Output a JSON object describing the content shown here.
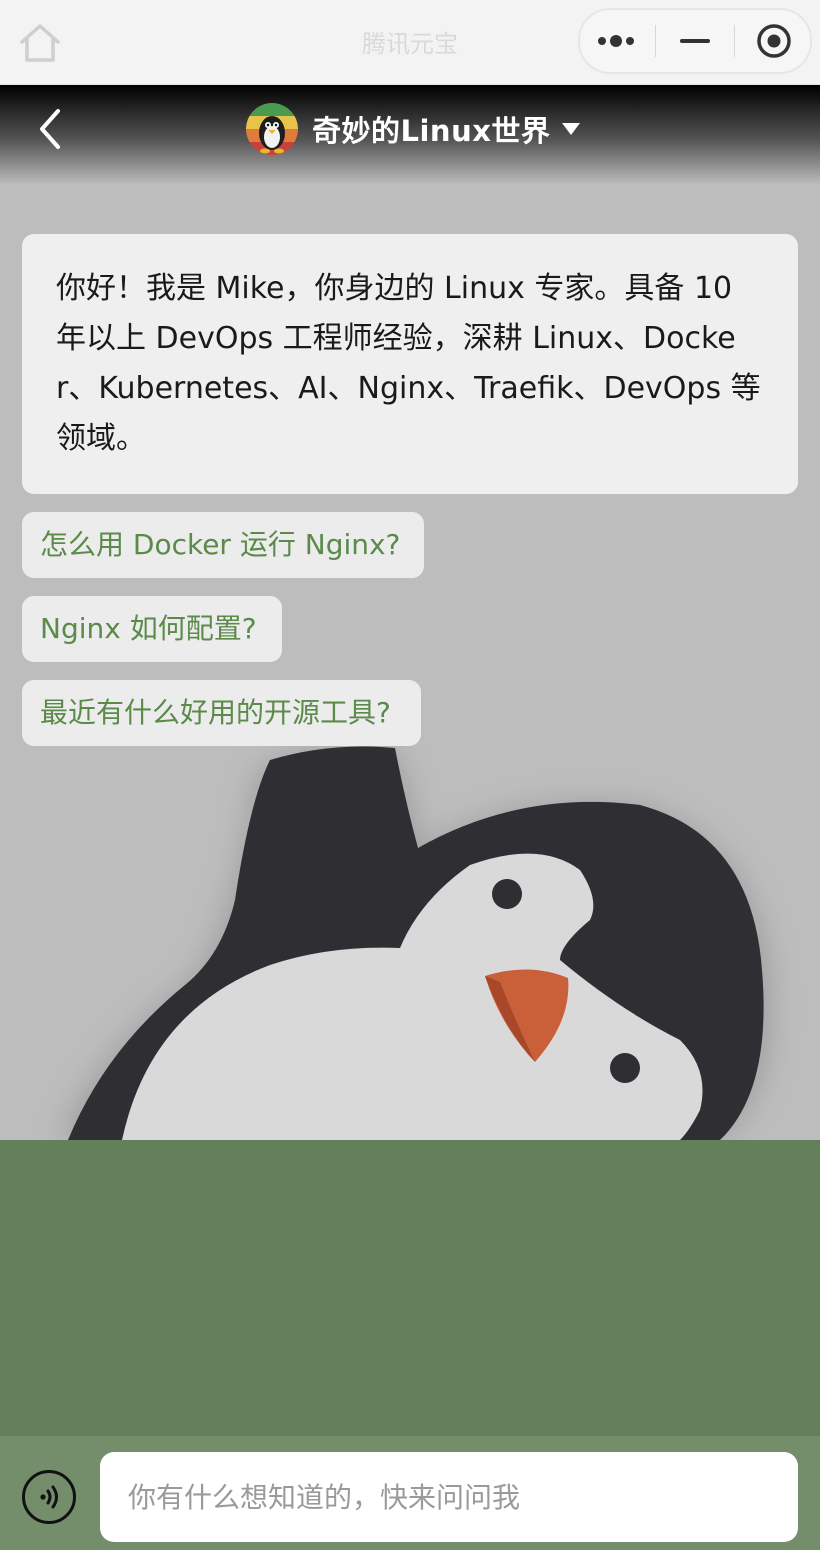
{
  "app": {
    "title": "腾讯元宝"
  },
  "header": {
    "title": "奇妙的Linux世界",
    "icons": [
      "back-icon",
      "tux-avatar",
      "caret-down-icon"
    ]
  },
  "capsule": {
    "icons": [
      "more-dots-icon",
      "minimize-icon",
      "close-target-icon"
    ]
  },
  "chat": {
    "greeting": "你好！我是 Mike，你身边的 Linux 专家。具备 10 年以上 DevOps 工程师经验，深耕 Linux、Docker、Kubernetes、AI、Nginx、Traefik、DevOps 等领域。",
    "suggestions": [
      "怎么用 Docker 运行 Nginx?",
      "Nginx 如何配置?",
      "最近有什么好用的开源工具?"
    ]
  },
  "input": {
    "placeholder": "你有什么想知道的，快来问问我"
  },
  "colors": {
    "ground": "#63805b",
    "bottombar": "#748e6c",
    "suggestion_text": "#5b8a4b",
    "penguin_dark": "#2f2f33",
    "beak": "#c9603a"
  }
}
